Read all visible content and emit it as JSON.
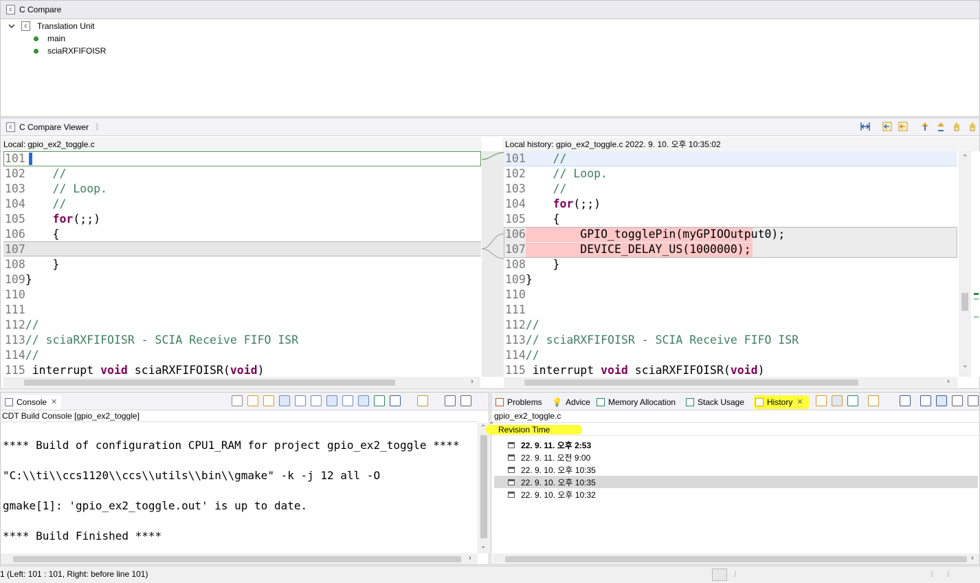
{
  "c_compare": {
    "title": "C Compare",
    "tree_root": "Translation Unit",
    "tree_items": [
      "main",
      "sciaRXFIFOISR"
    ]
  },
  "compare_viewer": {
    "title": "C Compare Viewer",
    "left_header": "Local: gpio_ex2_toggle.c",
    "right_header": "Local history: gpio_ex2_toggle.c 2022. 9. 10. 오후 10:35:02",
    "left_lines": [
      {
        "n": "101",
        "t": ""
      },
      {
        "n": "102",
        "t": "    //"
      },
      {
        "n": "103",
        "t": "    // Loop."
      },
      {
        "n": "104",
        "t": "    //"
      },
      {
        "n": "105",
        "t": "    for(;;)"
      },
      {
        "n": "106",
        "t": "    {"
      },
      {
        "n": "107",
        "t": ""
      },
      {
        "n": "108",
        "t": "    }"
      },
      {
        "n": "109",
        "t": "}"
      },
      {
        "n": "110",
        "t": ""
      },
      {
        "n": "111",
        "t": ""
      },
      {
        "n": "112",
        "t": "//"
      },
      {
        "n": "113",
        "t": "// sciaRXFIFOISR - SCIA Receive FIFO ISR"
      },
      {
        "n": "114",
        "t": "//"
      },
      {
        "n": "115",
        "t": " interrupt void sciaRXFIFOISR(void)"
      }
    ],
    "right_lines": [
      {
        "n": "101",
        "t": "    //"
      },
      {
        "n": "102",
        "t": "    // Loop."
      },
      {
        "n": "103",
        "t": "    //"
      },
      {
        "n": "104",
        "t": "    for(;;)"
      },
      {
        "n": "105",
        "t": "    {"
      },
      {
        "n": "106",
        "t": "        GPIO_togglePin(myGPIOOutput0);"
      },
      {
        "n": "107",
        "t": "        DEVICE_DELAY_US(1000000);"
      },
      {
        "n": "108",
        "t": "    }"
      },
      {
        "n": "109",
        "t": "}"
      },
      {
        "n": "110",
        "t": ""
      },
      {
        "n": "111",
        "t": ""
      },
      {
        "n": "112",
        "t": "//"
      },
      {
        "n": "113",
        "t": "// sciaRXFIFOISR - SCIA Receive FIFO ISR"
      },
      {
        "n": "114",
        "t": "//"
      },
      {
        "n": "115",
        "t": " interrupt void sciaRXFIFOISR(void)"
      }
    ]
  },
  "console": {
    "tab_label": "Console",
    "subtitle": "CDT Build Console [gpio_ex2_toggle]",
    "lines": [
      "**** Build of configuration CPU1_RAM for project gpio_ex2_toggle ****",
      "\"C:\\\\ti\\\\ccs1120\\\\ccs\\\\utils\\\\bin\\\\gmake\" -k -j 12 all -O",
      "gmake[1]: 'gpio_ex2_toggle.out' is up to date.",
      "**** Build Finished ****"
    ]
  },
  "history_panel": {
    "tabs": [
      "Problems",
      "Advice",
      "Memory Allocation",
      "Stack Usage",
      "History"
    ],
    "file": "gpio_ex2_toggle.c",
    "column": "Revision Time",
    "revisions": [
      "22. 9. 11. 오후 2:53",
      "22. 9. 11. 오전 9:00",
      "22. 9. 10. 오후 10:35",
      "22. 9. 10. 오후 10:35",
      "22. 9. 10. 오후 10:32"
    ]
  },
  "status_bar": {
    "text": "1 (Left: 101 : 101, Right: before line 101)"
  },
  "colors": {
    "diff_added": "#ffc8c8",
    "highlight": "#ffff00",
    "comment": "#3f7f5f",
    "keyword": "#7f0055"
  }
}
